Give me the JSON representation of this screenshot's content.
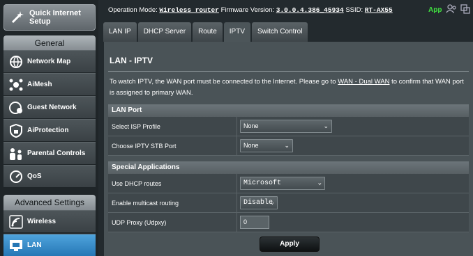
{
  "sidebar": {
    "quick_setup": "Quick Internet Setup",
    "general_title": "General",
    "general_items": [
      "Network Map",
      "AiMesh",
      "Guest Network",
      "AiProtection",
      "Parental Controls",
      "QoS"
    ],
    "advanced_title": "Advanced Settings",
    "advanced_items": [
      "Wireless",
      "LAN"
    ],
    "active_item": "LAN"
  },
  "topbar": {
    "mode_label": "Operation Mode:",
    "mode_value": "Wireless router",
    "fw_label": "Firmware Version:",
    "fw_value": "3.0.0.4.386_45934",
    "ssid_label": "SSID:",
    "ssid_value": "RT-AX55",
    "app_label": "App"
  },
  "tabs": [
    "LAN IP",
    "DHCP Server",
    "Route",
    "IPTV",
    "Switch Control"
  ],
  "active_tab": "IPTV",
  "page": {
    "title": "LAN - IPTV",
    "desc_pre": "To watch IPTV, the WAN port must be connected to the Internet. Please go to ",
    "desc_link": "WAN - Dual WAN",
    "desc_post": " to confirm that WAN port is assigned to primary WAN.",
    "lan_port": {
      "title": "LAN Port",
      "isp_label": "Select ISP Profile",
      "isp_value": "None",
      "stb_label": "Choose IPTV STB Port",
      "stb_value": "None"
    },
    "special": {
      "title": "Special Applications",
      "dhcp_label": "Use DHCP routes",
      "dhcp_value": "Microsoft",
      "mcast_label": "Enable multicast routing",
      "mcast_value": "Disable",
      "udp_label": "UDP Proxy (Udpxy)",
      "udp_value": "0"
    },
    "apply": "Apply"
  },
  "colors": {
    "accent": "#2a7fc0",
    "app_green": "#40e040"
  }
}
